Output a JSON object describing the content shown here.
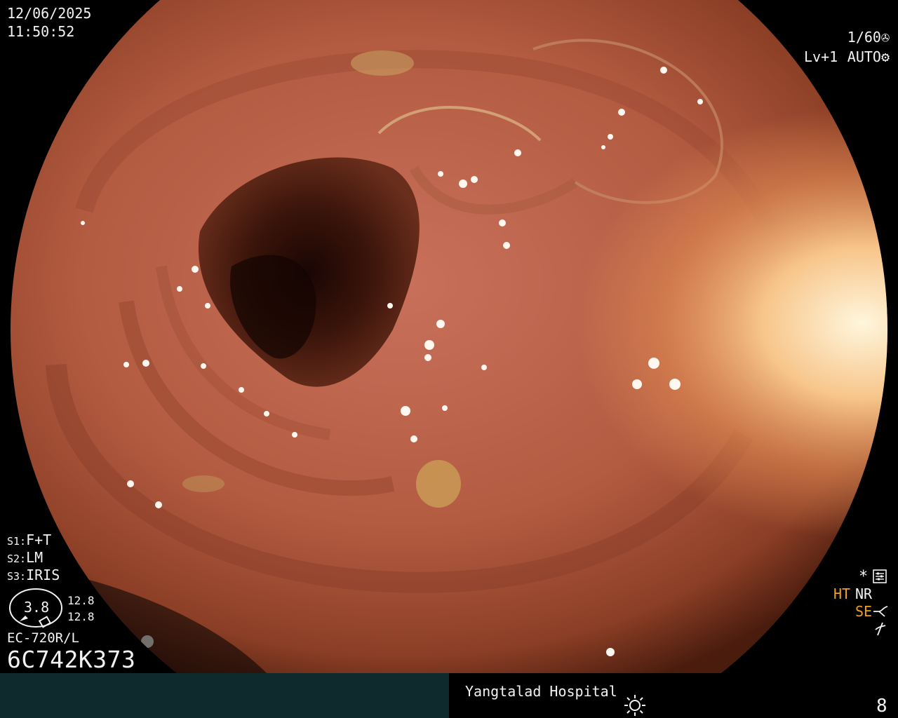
{
  "overlay": {
    "date": "12/06/2025",
    "time": "11:50:52",
    "shutter": "1/60",
    "shutter_icon": "shutter-icon",
    "level": "Lv+1",
    "auto_iris": "AUTO",
    "auto_iris_icon": "iris-icon",
    "s1": {
      "key": "S1:",
      "value": "F+T"
    },
    "s2": {
      "key": "S2:",
      "value": "LM"
    },
    "s3": {
      "key": "S3:",
      "value": "IRIS"
    },
    "zoom_value": "3.8",
    "zoom_right_1": "12.8",
    "zoom_right_2": "12.8",
    "scope_model": "EC-720R/L",
    "scope_serial": "6C742K373",
    "asterisk": "*",
    "settings_icon": "settings-icon",
    "ht": "HT",
    "nr": "NR",
    "se": "SE",
    "se_icon": "curve-icon",
    "filter_icon": "filter-icon"
  },
  "status_bar": {
    "hospital": "Yangtalad Hospital",
    "brightness_icon": "sun-icon",
    "count": "8"
  },
  "colors": {
    "accent": "#f0a020",
    "text": "#f2f2f2",
    "status_bar_left": "#0f2a2c",
    "mucosa": "#b45c42",
    "lumen": "#2a0f08"
  }
}
